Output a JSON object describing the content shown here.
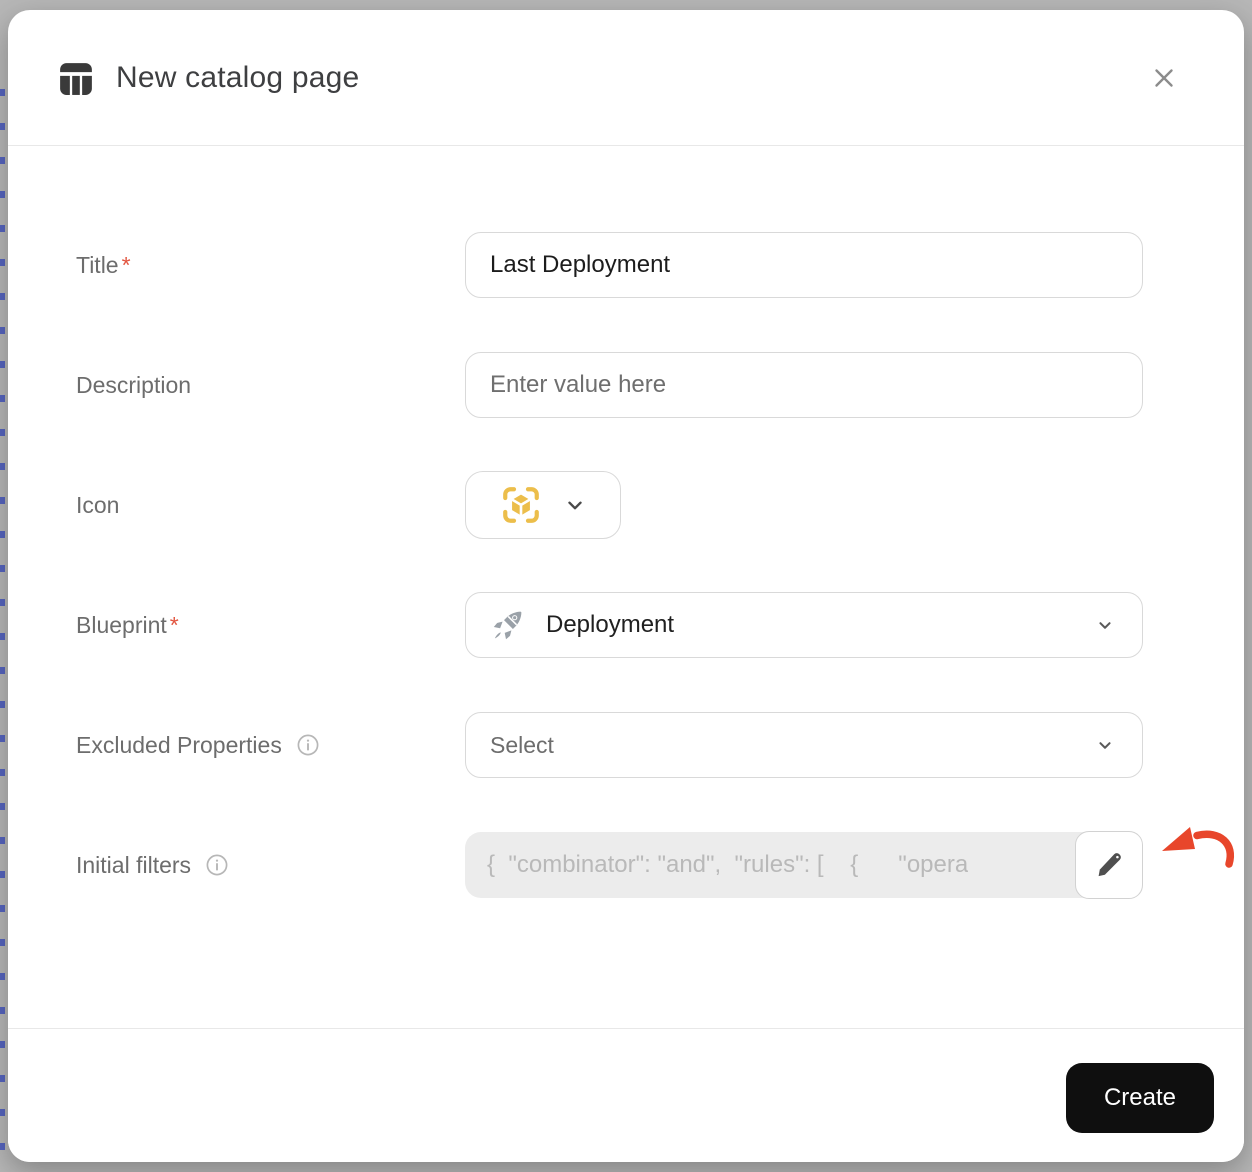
{
  "window": {
    "title": "New catalog page"
  },
  "form": {
    "title": {
      "label": "Title",
      "required_marker": "*",
      "value": "Last Deployment"
    },
    "description": {
      "label": "Description",
      "placeholder": "Enter value here"
    },
    "icon": {
      "label": "Icon",
      "selected_icon": "cube-scan-icon"
    },
    "blueprint": {
      "label": "Blueprint",
      "required_marker": "*",
      "selected": "Deployment",
      "selected_icon": "rocket-icon"
    },
    "excluded_properties": {
      "label": "Excluded Properties",
      "placeholder": "Select"
    },
    "initial_filters": {
      "label": "Initial filters",
      "value": "{  \"combinator\": \"and\",  \"rules\": [    {      \"opera"
    }
  },
  "footer": {
    "create_label": "Create"
  },
  "colors": {
    "icon_accent_yellow": "#ECBE4B",
    "required_red": "#E25540",
    "annotation_arrow_red": "#E8462B",
    "create_button_bg": "#0F0F0F"
  }
}
